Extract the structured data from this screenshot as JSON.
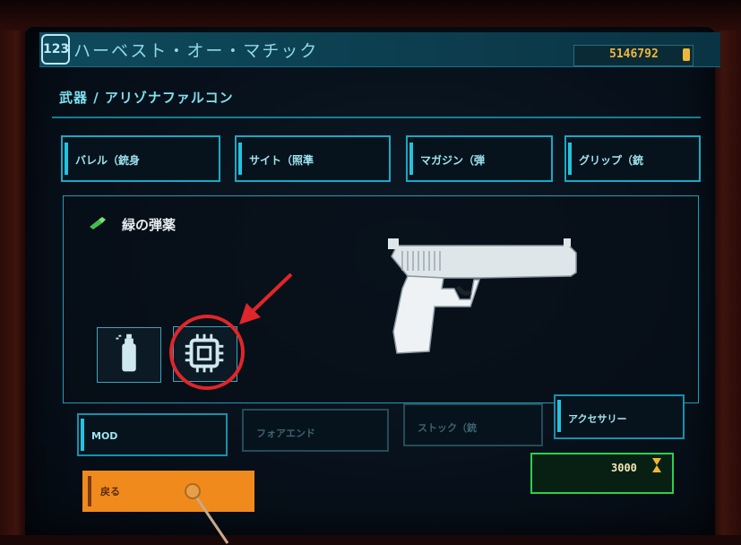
{
  "header": {
    "logo": "123",
    "app_title": "ハーベスト・オー・マチック",
    "money": "5146792"
  },
  "breadcrumb": "武器 / アリゾナファルコン",
  "top_tabs": [
    {
      "label": "バレル（銃身"
    },
    {
      "label": "サイト（照準"
    },
    {
      "label": "マガジン（弾"
    },
    {
      "label": "グリップ（銃"
    }
  ],
  "item": {
    "name": "緑の弾薬",
    "icon": "ammo-icon",
    "accent": "#3fbf4a"
  },
  "slots": [
    {
      "icon": "spray-can-icon"
    },
    {
      "icon": "chip-icon",
      "highlighted": true
    }
  ],
  "bottom_tabs": [
    {
      "label": "MOD",
      "enabled": true
    },
    {
      "label": "フォアエンド",
      "enabled": false
    },
    {
      "label": "ストック（銃",
      "enabled": false
    },
    {
      "label": "アクセサリー",
      "enabled": true
    }
  ],
  "cost": "3000",
  "back_button": {
    "label": "戻る"
  },
  "colors": {
    "accent": "#17a9c6",
    "money": "#f0b63a",
    "cost_border": "#2ad14a",
    "back": "#f08a1d",
    "highlight": "#e0262a"
  }
}
